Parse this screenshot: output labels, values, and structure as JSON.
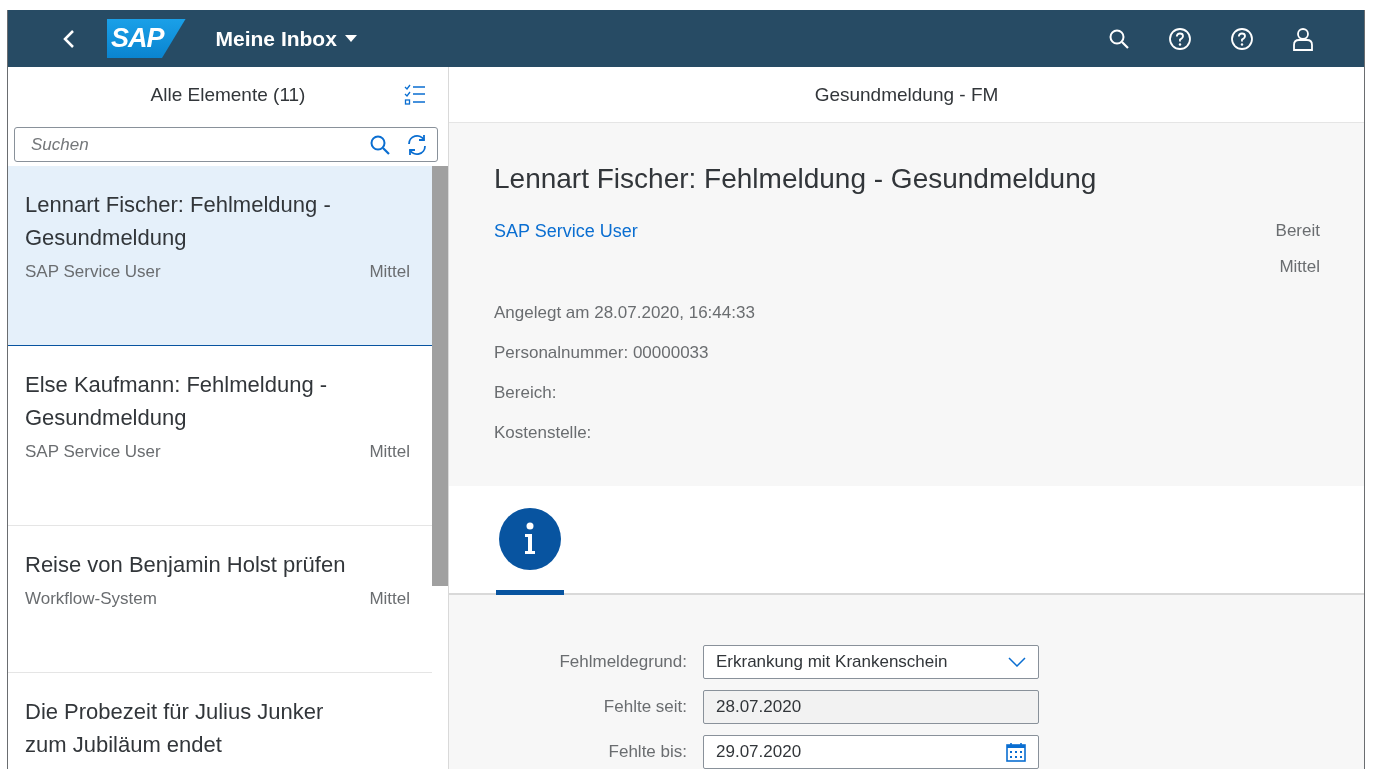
{
  "shell": {
    "title": "Meine Inbox",
    "logo": "SAP"
  },
  "list": {
    "title": "Alle Elemente (11)",
    "search": {
      "placeholder": "Suchen"
    },
    "items": [
      {
        "title": "Lennart Fischer: Fehlmeldung - Gesundmeldung",
        "creator": "SAP Service User",
        "priority": "Mittel",
        "selected": true
      },
      {
        "title": "Else Kaufmann: Fehlmeldung - Gesundmeldung",
        "creator": "SAP Service User",
        "priority": "Mittel",
        "selected": false
      },
      {
        "title": "Reise von Benjamin Holst prüfen",
        "creator": "Workflow-System",
        "priority": "Mittel",
        "selected": false
      },
      {
        "title": "Die Probezeit für Julius Junker zum Jubiläum endet",
        "selected": false
      }
    ]
  },
  "detail": {
    "page_title": "Gesundmeldung - FM",
    "heading": "Lennart Fischer: Fehlmeldung - Gesundmeldung",
    "creator": "SAP Service User",
    "status": "Bereit",
    "priority": "Mittel",
    "attributes": [
      "Angelegt am 28.07.2020, 16:44:33",
      "Personalnummer: 00000033",
      "Bereich:",
      "Kostenstelle:"
    ],
    "tabs": [
      {
        "kind": "info",
        "selected": true
      }
    ],
    "form": [
      {
        "label": "Fehlmeldegrund:",
        "value": "Erkrankung mit Krankenschein",
        "kind": "select",
        "disabled": false
      },
      {
        "label": "Fehlte seit:",
        "value": "28.07.2020",
        "kind": "text",
        "disabled": true
      },
      {
        "label": "Fehlte bis:",
        "value": "29.07.2020",
        "kind": "date",
        "disabled": false
      }
    ]
  }
}
